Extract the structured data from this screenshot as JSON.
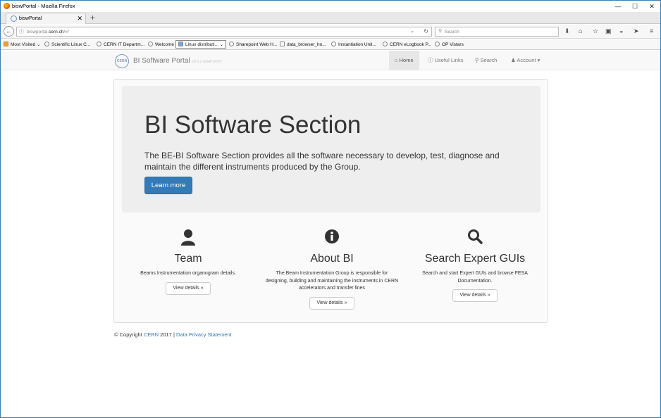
{
  "window": {
    "title": "biswPortal - Mozilla Firefox",
    "min": "—",
    "max": "☐",
    "close": "✕"
  },
  "tabs": [
    {
      "label": "biswPortal",
      "close": "✕"
    }
  ],
  "new_tab": "+",
  "navbar": {
    "url_prefix": "biswportal.",
    "url_domain": "cern.ch",
    "url_suffix": "/#/",
    "search_placeholder": "Search"
  },
  "bookmarks": [
    "Most Visited",
    "Scientific Linux C...",
    "CERN IT Departm...",
    "Welcome",
    "Linux distributi...",
    "Sharepoint Web H...",
    "data_browser_ho...",
    "Instantiation Unit...",
    "CERN eLogbook P...",
    "OP Vistars"
  ],
  "site": {
    "brand": "BI Software Portal",
    "version": "v0.0.1-SNAPSHOT",
    "logo_text": "CERN",
    "nav": {
      "home": "Home",
      "links": "Useful Links",
      "search": "Search",
      "account": "Account"
    }
  },
  "jumbotron": {
    "title": "BI Software Section",
    "text": "The BE-BI Software Section provides all the software necessary to develop, test, diagnose and maintain the different instruments produced by the Group.",
    "button": "Learn more"
  },
  "columns": [
    {
      "title": "Team",
      "text": "Beams Instrumentation organogram details.",
      "button": "View details »",
      "icon": "user-icon"
    },
    {
      "title": "About BI",
      "text": "The Beam Instrumentation Group is responsible for designing, building and maintaining the instruments in CERN accelerators and transfer lines",
      "button": "View details »",
      "icon": "info-icon"
    },
    {
      "title": "Search Expert GUIs",
      "text": "Search and start Expert GUIs and browse FESA Documentation.",
      "button": "View details »",
      "icon": "search-icon"
    }
  ],
  "footer": {
    "prefix": "© Copyright",
    "cern": "CERN",
    "year": "2017 |",
    "privacy": "Data Privacy Statement"
  },
  "colors": {
    "primary": "#337ab7",
    "jumbotron_bg": "#eeeeee",
    "navbar_bg": "#f8f8f8"
  }
}
